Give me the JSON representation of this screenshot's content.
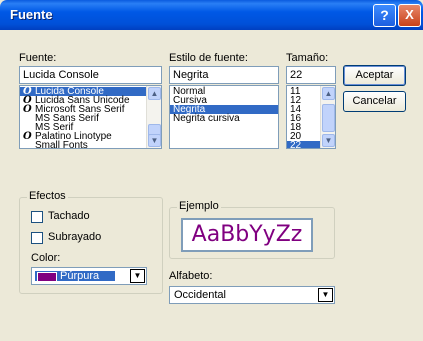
{
  "window": {
    "title": "Fuente"
  },
  "titlebar": {
    "help_glyph": "?",
    "close_glyph": "X"
  },
  "font": {
    "label": "Fuente:",
    "value": "Lucida Console",
    "items": [
      {
        "icon": "opentype-icon",
        "glyph": "O",
        "label": "Lucida Console",
        "selected": true
      },
      {
        "icon": "opentype-icon",
        "glyph": "O",
        "label": "Lucida Sans Unicode"
      },
      {
        "icon": "opentype-icon",
        "glyph": "O",
        "label": "Microsoft Sans Serif"
      },
      {
        "icon": "",
        "glyph": "",
        "label": "MS Sans Serif"
      },
      {
        "icon": "",
        "glyph": "",
        "label": "MS Serif"
      },
      {
        "icon": "opentype-icon",
        "glyph": "O",
        "label": "Palatino Linotype"
      },
      {
        "icon": "",
        "glyph": "",
        "label": "Small Fonts"
      }
    ]
  },
  "style": {
    "label": "Estilo de fuente:",
    "value": "Negrita",
    "items": [
      {
        "label": "Normal"
      },
      {
        "label": "Cursiva"
      },
      {
        "label": "Negrita",
        "selected": true
      },
      {
        "label": "Negrita cursiva"
      }
    ]
  },
  "size": {
    "label": "Tamaño:",
    "value": "22",
    "items": [
      {
        "label": "11"
      },
      {
        "label": "12"
      },
      {
        "label": "14"
      },
      {
        "label": "16"
      },
      {
        "label": "18"
      },
      {
        "label": "20"
      },
      {
        "label": "22",
        "selected": true
      }
    ]
  },
  "buttons": {
    "ok": "Aceptar",
    "cancel": "Cancelar"
  },
  "effects": {
    "label": "Efectos",
    "strikeout": "Tachado",
    "underline": "Subrayado",
    "color_label": "Color:",
    "color_value": "Púrpura",
    "color_swatch": "#800080"
  },
  "sample": {
    "label": "Ejemplo",
    "text": "AaBbYyZz",
    "color": "#800080"
  },
  "script": {
    "label": "Alfabeto:",
    "value": "Occidental"
  },
  "colors": {
    "accent": "#316ac5",
    "titlebar": "#0058e6"
  }
}
